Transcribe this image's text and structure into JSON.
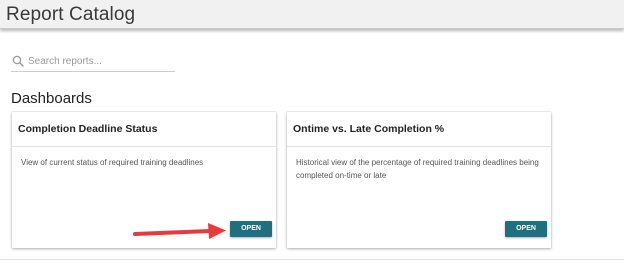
{
  "header": {
    "title": "Report Catalog"
  },
  "search": {
    "placeholder": "Search reports...",
    "value": "",
    "icon": "search-icon"
  },
  "section": {
    "title": "Dashboards"
  },
  "cards": [
    {
      "title": "Completion Deadline Status",
      "description": "View of current status of required training deadlines",
      "button_label": "OPEN"
    },
    {
      "title": "Ontime vs. Late Completion %",
      "description": "Historical view of the percentage of required training deadlines being completed on-time or late",
      "button_label": "OPEN"
    }
  ],
  "colors": {
    "accent_button": "#1f6f7e",
    "annotation_arrow": "#e8393c",
    "header_bg": "#f1f1f1"
  }
}
